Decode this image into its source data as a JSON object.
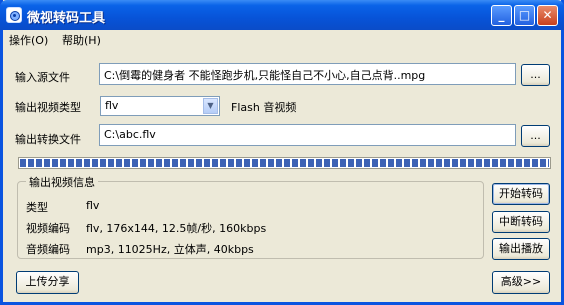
{
  "window": {
    "title": "微视转码工具",
    "min": "_",
    "max": "□",
    "close": "✕"
  },
  "menu": {
    "items": [
      "操作(O)",
      "帮助(H)"
    ]
  },
  "form": {
    "source_label": "输入源文件",
    "source_value": "C:\\倒霉的健身者 不能怪跑步机,只能怪自己不小心,自己点背..mpg",
    "browse_label": "...",
    "type_label": "输出视频类型",
    "type_value": "flv",
    "type_desc": "Flash 音视频",
    "output_label": "输出转换文件",
    "output_value": "C:\\abc.flv"
  },
  "progress": {
    "value": 1.0
  },
  "info": {
    "title": "输出视频信息",
    "rows": [
      {
        "label": "类型",
        "value": "flv"
      },
      {
        "label": "视频编码",
        "value": "flv, 176x144, 12.5帧/秒, 160kbps"
      },
      {
        "label": "音频编码",
        "value": "mp3, 11025Hz, 立体声, 40kbps"
      }
    ]
  },
  "actions": {
    "start": "开始转码",
    "stop": "中断转码",
    "play": "输出播放",
    "upload": "上传分享",
    "advanced": "高级>>"
  }
}
